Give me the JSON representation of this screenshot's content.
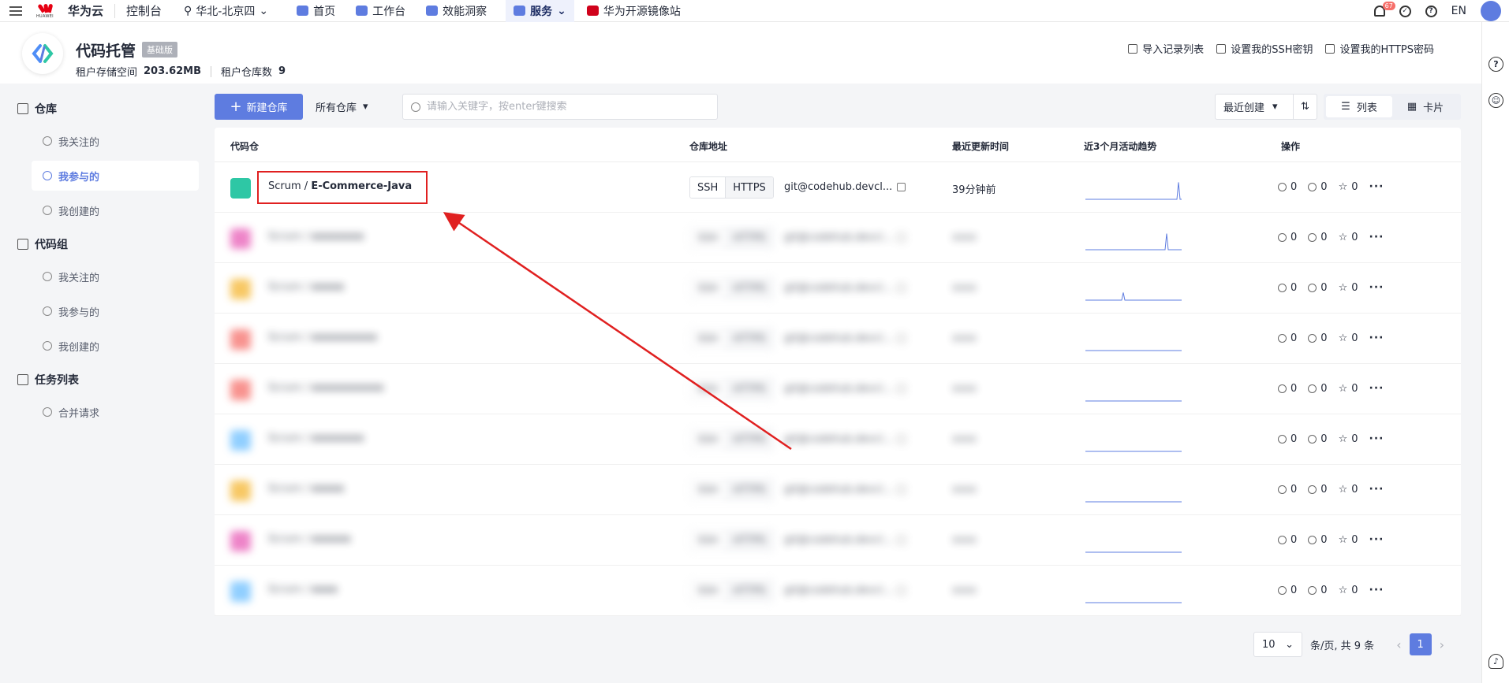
{
  "topnav": {
    "logo_sub": "HUAWEI",
    "brand": "华为云",
    "console": "控制台",
    "region": "华北-北京四",
    "items": [
      {
        "label": "首页"
      },
      {
        "label": "工作台"
      },
      {
        "label": "效能洞察"
      },
      {
        "label": "服务"
      },
      {
        "label": "华为开源镜像站"
      }
    ],
    "notif_count": "67",
    "lang": "EN"
  },
  "header": {
    "title": "代码托管",
    "edition": "基础版",
    "storage_label": "租户存储空间",
    "storage_value": "203.62MB",
    "repo_count_label": "租户仓库数",
    "repo_count_value": "9",
    "actions": [
      "导入记录列表",
      "设置我的SSH密钥",
      "设置我的HTTPS密码"
    ]
  },
  "sidebar": {
    "groups": [
      {
        "label": "仓库",
        "items": [
          "我关注的",
          "我参与的",
          "我创建的"
        ]
      },
      {
        "label": "代码组",
        "items": [
          "我关注的",
          "我参与的",
          "我创建的"
        ]
      },
      {
        "label": "任务列表",
        "items": [
          "合并请求"
        ]
      }
    ],
    "active": "我参与的"
  },
  "toolbar": {
    "new_repo": "新建仓库",
    "filter": "所有仓库",
    "search_placeholder": "请输入关键字，按enter键搜索",
    "sort": "最近创建",
    "view_list": "列表",
    "view_card": "卡片"
  },
  "table": {
    "headers": [
      "代码仓",
      "仓库地址",
      "最近更新时间",
      "近3个月活动趋势",
      "操作"
    ],
    "rows": [
      {
        "group": "Scrum",
        "name": "E-Commerce-Java",
        "ssh": "SSH",
        "https": "HTTPS",
        "address": "git@codehub.devcl...",
        "updated": "39分钟前",
        "mr": "0",
        "fork": "0",
        "star": "0",
        "icon_color": "#2ec7a5",
        "trend_peak": 0.9,
        "blurred": false
      },
      {
        "group": "Scrum",
        "name": "xxxxxxxx",
        "ssh": "SSH",
        "https": "HTTPS",
        "address": "git@codehub.devcl...",
        "updated": "xxxx",
        "mr": "0",
        "fork": "0",
        "star": "0",
        "icon_color": "#e85bb6",
        "trend_peak": 0.85,
        "blurred": true
      },
      {
        "group": "Scrum",
        "name": "xxxxx",
        "ssh": "SSH",
        "https": "HTTPS",
        "address": "git@codehub.devcl...",
        "updated": "xxxx",
        "mr": "0",
        "fork": "0",
        "star": "0",
        "icon_color": "#f5b631",
        "trend_peak": 0.4,
        "blurred": true
      },
      {
        "group": "Scrum",
        "name": "xxxxxxxxxx",
        "ssh": "SSH",
        "https": "HTTPS",
        "address": "git@codehub.devcl...",
        "updated": "xxxx",
        "mr": "0",
        "fork": "0",
        "star": "0",
        "icon_color": "#f66f6a",
        "trend_peak": 0,
        "blurred": true
      },
      {
        "group": "Scrum",
        "name": "xxxxxxxxxxx",
        "ssh": "SSH",
        "https": "HTTPS",
        "address": "git@codehub.devcl...",
        "updated": "xxxx",
        "mr": "0",
        "fork": "0",
        "star": "0",
        "icon_color": "#f66f6a",
        "trend_peak": 0,
        "blurred": true
      },
      {
        "group": "Scrum",
        "name": "xxxxxxxx",
        "ssh": "SSH",
        "https": "HTTPS",
        "address": "git@codehub.devcl...",
        "updated": "xxxx",
        "mr": "0",
        "fork": "0",
        "star": "0",
        "icon_color": "#6cbfff",
        "trend_peak": 0,
        "blurred": true
      },
      {
        "group": "Scrum",
        "name": "xxxxx",
        "ssh": "SSH",
        "https": "HTTPS",
        "address": "git@codehub.devcl...",
        "updated": "xxxx",
        "mr": "0",
        "fork": "0",
        "star": "0",
        "icon_color": "#f5b631",
        "trend_peak": 0,
        "blurred": true
      },
      {
        "group": "Scrum",
        "name": "xxxxxx",
        "ssh": "SSH",
        "https": "HTTPS",
        "address": "git@codehub.devcl...",
        "updated": "xxxx",
        "mr": "0",
        "fork": "0",
        "star": "0",
        "icon_color": "#e85bb6",
        "trend_peak": 0,
        "blurred": true
      },
      {
        "group": "Scrum",
        "name": "xxxx",
        "ssh": "SSH",
        "https": "HTTPS",
        "address": "git@codehub.devcl...",
        "updated": "xxxx",
        "mr": "0",
        "fork": "0",
        "star": "0",
        "icon_color": "#6cbfff",
        "trend_peak": 0,
        "blurred": true
      }
    ]
  },
  "pager": {
    "size": "10",
    "summary": "条/页, 共 9 条",
    "page": "1"
  },
  "colors": {
    "primary": "#5e7ce0",
    "annotation": "#e02020"
  }
}
